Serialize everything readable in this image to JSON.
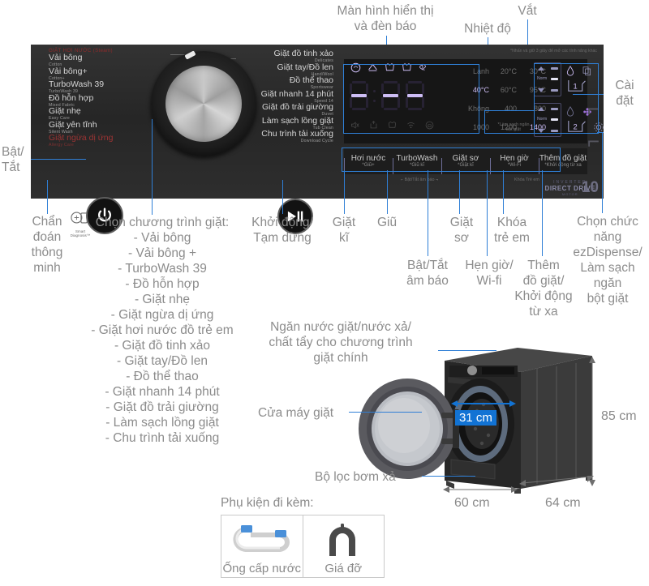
{
  "annotations": {
    "display_panel": "Màn hình hiển thị\nvà đèn báo",
    "temperature": "Nhiệt độ",
    "spin": "Vắt",
    "settings": "Cài\nđặt",
    "power": "Bật/\nTắt",
    "smart_diagnosis": "Chẩn\nđoán\nthông\nminh",
    "program_select": "Chọn chương trình giặt:\n- Vải bông\n- Vải bông +\n- TurboWash 39\n- Đồ hỗn hợp\n- Giặt nhẹ\n- Giặt ngừa dị ứng\n- Giặt hơi nước đồ trẻ em\n- Giặt đồ tinh xảo\n- Giặt tay/Đồ len\n- Đồ thể thao\n- Giặt nhanh 14 phút\n- Giặt đồ trải giường\n- Làm sạch lồng giặt\n- Chu trình tải xuống",
    "start_pause": "Khởi động/\nTạm dừng",
    "intensive_wash": "Giặt\nkĩ",
    "hold": "Giũ",
    "sound_toggle": "Bật/Tắt\nâm báo",
    "prewash": "Giặt\nsơ",
    "timer_wifi": "Hẹn giờ/\nWi-fi",
    "child_lock": "Khóa\ntrẻ em",
    "add_laundry": "Thêm\nđồ giặt/\nKhởi động\ntừ xa",
    "ez_dispense": "Chọn chức\nnăng\nezDispense/\nLàm sạch\nngăn\nbột giặt",
    "dispenser_drawer": "Ngăn nước giặt/nước xả/\nchất tẩy cho chương trình\ngiặt chính",
    "door": "Cửa máy giặt",
    "drain_filter": "Bộ lọc bơm xả"
  },
  "panel": {
    "red_header": "GIẶT HƠI NƯỚC (Steam)",
    "programs_left": [
      {
        "vn": "Vải bông",
        "en": "Cotton",
        "red": false
      },
      {
        "vn": "Vải bông+",
        "en": "Cotton+",
        "red": false
      },
      {
        "vn": "TurboWash 39",
        "en": "TurboWash 39",
        "red": false
      },
      {
        "vn": "Đồ hỗn hợp",
        "en": "Mixed Fabric",
        "red": false
      },
      {
        "vn": "Giặt nhẹ",
        "en": "Easy Care",
        "red": false
      },
      {
        "vn": "Giặt yên tĩnh",
        "en": "Silent Wash",
        "red": false
      },
      {
        "vn": "Giặt ngừa dị ứng",
        "en": "Allergy Care",
        "red": true
      }
    ],
    "programs_right": [
      {
        "vn": "Giặt đồ tinh xảo",
        "en": "Delicates"
      },
      {
        "vn": "Giặt tay/Đồ len",
        "en": "Hand/Wool"
      },
      {
        "vn": "Đồ thể thao",
        "en": "Sportswear"
      },
      {
        "vn": "Giặt nhanh 14 phút",
        "en": "Speed 14"
      },
      {
        "vn": "Giặt đồ trải giường",
        "en": "Duvet"
      },
      {
        "vn": "Làm sạch lồng giặt",
        "en": "Tub Clean"
      },
      {
        "vn": "Chu trình tải xuống",
        "en": "Download Cycle"
      }
    ],
    "smart_diagnosis_label": "Smart\nDiagnosis™",
    "top_note": "*Nhấn và giữ 3 giây để mở các tính năng khác",
    "buttons": [
      {
        "t1": "Hơi nước",
        "t2": "*Giũ+"
      },
      {
        "t1": "TurboWash",
        "t2": "*Giũ kĩ"
      },
      {
        "t1": "Giặt sơ",
        "t2": "*Giặt kĩ"
      },
      {
        "t1": "Hẹn giờ",
        "t2": "*Wi-Fi"
      },
      {
        "t1": "Thêm đồ giặt",
        "t2": "*Khởi động từ xa"
      }
    ],
    "sub_notes": [
      {
        "text": "⌐ Bật/Tắt âm báo ¬"
      },
      {
        "text": "Khóa Trẻ em"
      }
    ],
    "brand": {
      "b1": "INVERTER",
      "b2": "DIRECT DRIVE",
      "b3": "MOTOR",
      "years": "10"
    },
    "display": {
      "segment_value": "- - -",
      "temperature_options": [
        "Lạnh",
        "20°C",
        "30°C",
        "40°C",
        "60°C",
        "95°C"
      ],
      "temperature_selected": "40°C",
      "spin_options": [
        "Không",
        "400",
        "800",
        "1000",
        "1200",
        "1400"
      ],
      "spin_selected": "1400",
      "dispense_note": "*Làm sạch ngăn\nbột giặt",
      "slot1": "1",
      "slot2": "2",
      "norm_label": "Norm"
    }
  },
  "machine": {
    "width": "60 cm",
    "depth": "64 cm",
    "height": "85 cm",
    "door_diameter": "31 cm"
  },
  "accessories": {
    "title": "Phụ kiện đi kèm:",
    "items": [
      {
        "label": "Ống cấp nước",
        "icon": "water-hose-icon"
      },
      {
        "label": "Giá đỡ",
        "icon": "support-bracket-icon"
      }
    ]
  },
  "colors": {
    "accent": "#2f7fd6",
    "badge": "#1273d4",
    "panel": "#2b2b2b",
    "display_text": "#cdbdf5",
    "annotation": "#8a8a8a"
  }
}
